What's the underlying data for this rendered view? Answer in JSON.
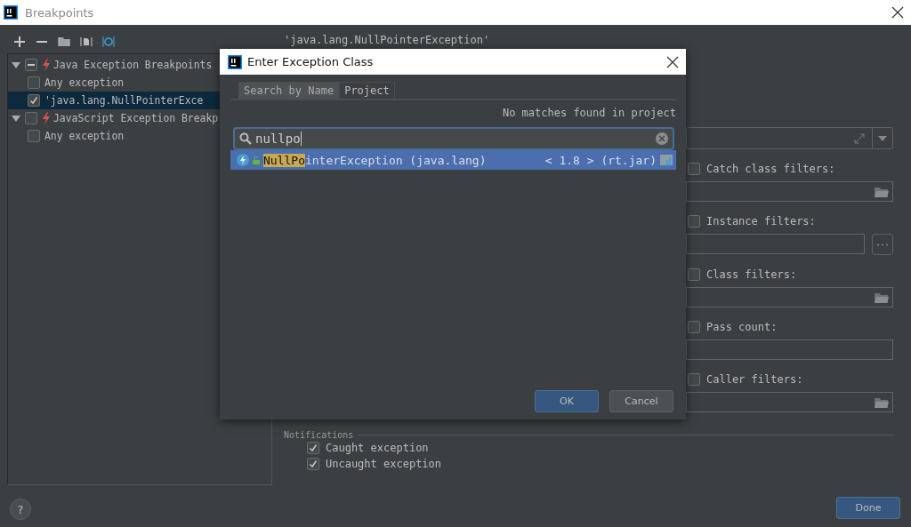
{
  "window": {
    "title": "Breakpoints"
  },
  "toolbar": [
    {
      "kind": "add"
    },
    {
      "kind": "remove"
    },
    {
      "kind": "folder"
    },
    {
      "kind": "group"
    },
    {
      "kind": "target"
    }
  ],
  "tree": [
    {
      "label": "Java Exception Breakpoints",
      "kind": "group",
      "checked": true,
      "mixed": true,
      "expanded": true,
      "selected": false,
      "children": [
        {
          "label": "Any exception",
          "checked": false,
          "selected": false
        },
        {
          "label": "'java.lang.NullPointerExce",
          "checked": true,
          "selected": true
        }
      ]
    },
    {
      "label": "JavaScript Exception Breakp",
      "kind": "group",
      "checked": false,
      "expanded": true,
      "selected": false,
      "children": [
        {
          "label": "Any exception",
          "checked": false,
          "selected": false
        }
      ]
    }
  ],
  "details": {
    "title": "'java.lang.NullPointerException'",
    "filters": [
      {
        "label": "Catch class filters:",
        "checked": false,
        "kind": "browse"
      },
      {
        "label": "Instance filters:",
        "checked": false,
        "kind": "more"
      },
      {
        "label": "Class filters:",
        "checked": false,
        "kind": "browse"
      },
      {
        "label": "Pass count:",
        "checked": false,
        "kind": "plain"
      },
      {
        "label": "Caller filters:",
        "checked": false,
        "kind": "browse"
      }
    ],
    "notifications": {
      "title": "Notifications",
      "options": [
        {
          "label": "Caught exception",
          "checked": true
        },
        {
          "label": "Uncaught exception",
          "checked": true
        }
      ]
    }
  },
  "dialog": {
    "title": "Enter Exception Class",
    "tabs": [
      {
        "label": "Search by Name",
        "selected": true
      },
      {
        "label": "Project",
        "selected": false
      }
    ],
    "message": "No matches found in project",
    "search": {
      "value": "nullpo"
    },
    "results": [
      {
        "match": "NullPo",
        "rest": "interException (java.lang)",
        "location": "< 1.8 > (rt.jar)",
        "selected": true
      }
    ],
    "buttons": [
      {
        "label": "OK",
        "kind": "primary"
      },
      {
        "label": "Cancel",
        "kind": "secondary"
      }
    ]
  },
  "footer": {
    "help": "?",
    "buttons": [
      {
        "label": "Done",
        "kind": "primary"
      }
    ]
  }
}
